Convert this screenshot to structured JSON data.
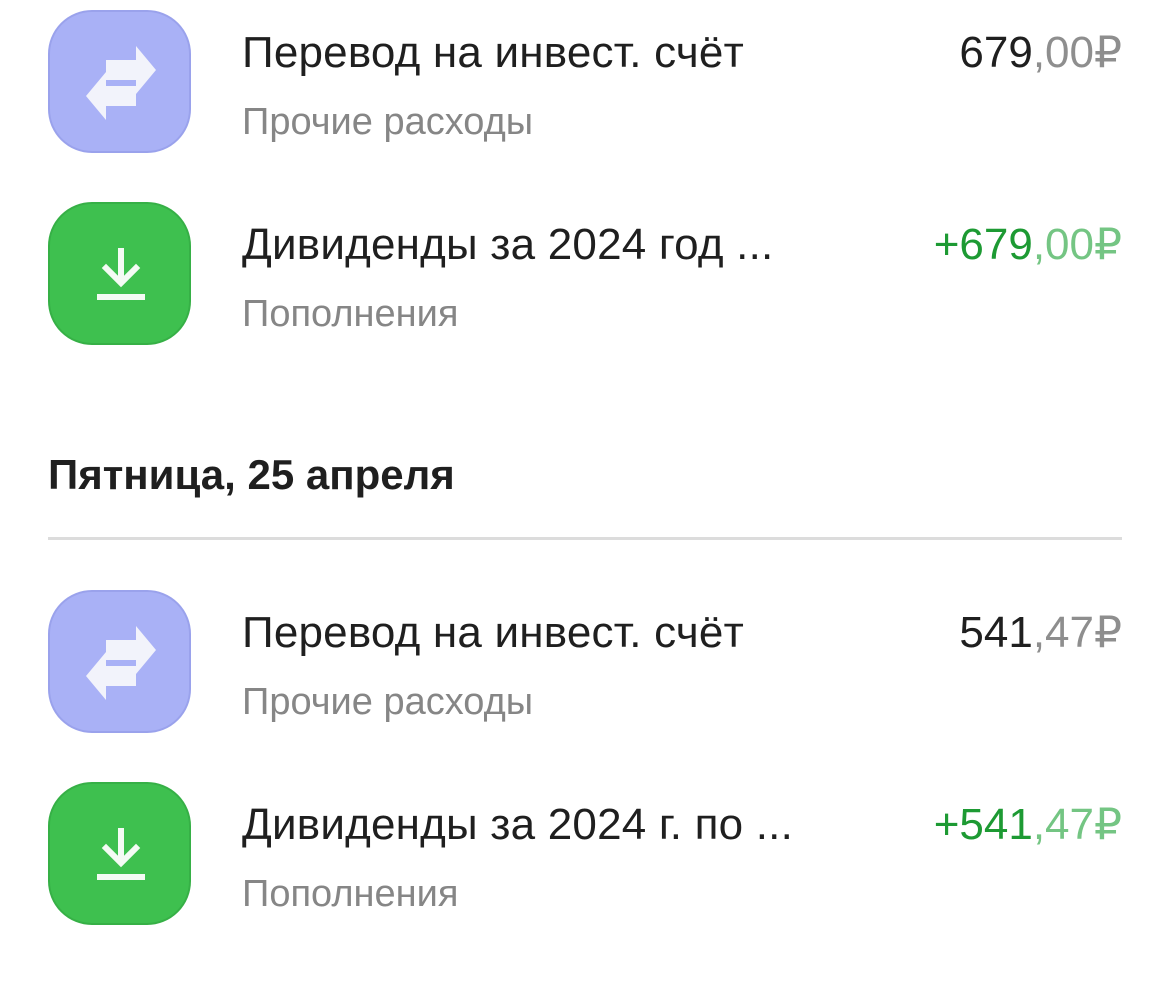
{
  "transactions_top": [
    {
      "title": "Перевод на инвест. счёт",
      "category": "Прочие расходы",
      "amount_int": "679",
      "amount_frac": ",00",
      "currency": "₽",
      "icon": "transfer-arrows-icon",
      "icon_color": "#a9b1f6",
      "type": "expense"
    },
    {
      "title": "Дивиденды за 2024 год ...",
      "category": "Пополнения",
      "amount_int": "+679",
      "amount_frac": ",00",
      "currency": "₽",
      "icon": "download-arrow-icon",
      "icon_color": "#3ec04f",
      "type": "income"
    }
  ],
  "day_section": {
    "header": "Пятница, 25 апреля",
    "transactions": [
      {
        "title": "Перевод на инвест. счёт",
        "category": "Прочие расходы",
        "amount_int": "541",
        "amount_frac": ",47",
        "currency": "₽",
        "icon": "transfer-arrows-icon",
        "icon_color": "#a9b1f6",
        "type": "expense"
      },
      {
        "title": "Дивиденды за 2024 г. по ...",
        "category": "Пополнения",
        "amount_int": "+541",
        "amount_frac": ",47",
        "currency": "₽",
        "icon": "download-arrow-icon",
        "icon_color": "#3ec04f",
        "type": "income"
      }
    ]
  },
  "colors": {
    "income_green": "#1d9a33",
    "income_green_light": "#74c583",
    "muted_gray": "#868686"
  }
}
